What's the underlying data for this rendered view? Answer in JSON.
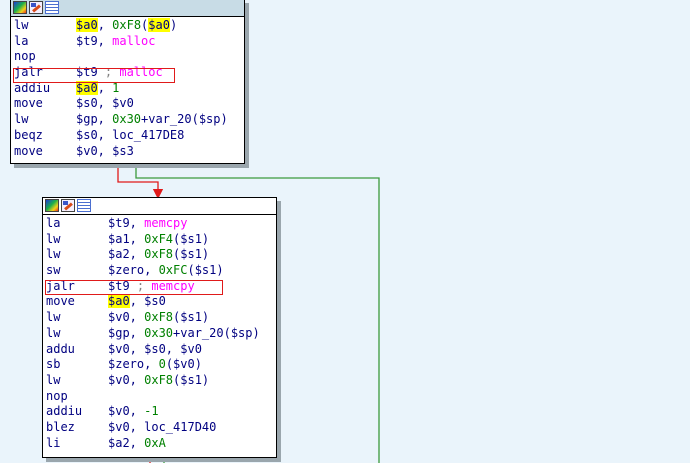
{
  "colors": {
    "background": "#eaf4fb",
    "mnemonic_text": "#000080",
    "symbol": "#ff00ff",
    "number": "#008000",
    "register_highlight": "#ffff00",
    "comment": "#808080",
    "edge_true": "#e01a1a",
    "edge_false": "#3c9a3c"
  },
  "header_icons": [
    "graph-overview-icon",
    "edit-node-icon",
    "listing-icon"
  ],
  "block1": {
    "lines": [
      {
        "mn": "lw",
        "ops": [
          {
            "t": "$a0",
            "k": "hl"
          },
          {
            "t": ", "
          },
          {
            "t": "0xF8",
            "k": "num"
          },
          {
            "t": "("
          },
          {
            "t": "$a0",
            "k": "hl"
          },
          {
            "t": ")"
          }
        ]
      },
      {
        "mn": "la",
        "ops": [
          {
            "t": "$t9, "
          },
          {
            "t": "malloc",
            "k": "sym"
          }
        ]
      },
      {
        "mn": "nop",
        "ops": []
      },
      {
        "mn": "jalr",
        "ops": [
          {
            "t": "$t9 "
          },
          {
            "t": "; ",
            "k": "cmt"
          },
          {
            "t": "malloc",
            "k": "sym"
          }
        ],
        "boxed": true
      },
      {
        "mn": "addiu",
        "ops": [
          {
            "t": "$a0",
            "k": "hl"
          },
          {
            "t": ", "
          },
          {
            "t": "1",
            "k": "num"
          }
        ]
      },
      {
        "mn": "move",
        "ops": [
          {
            "t": "$s0, $v0"
          }
        ]
      },
      {
        "mn": "lw",
        "ops": [
          {
            "t": "$gp, "
          },
          {
            "t": "0x30",
            "k": "num"
          },
          {
            "t": "+var_20($sp)"
          }
        ]
      },
      {
        "mn": "beqz",
        "ops": [
          {
            "t": "$s0, loc_417DE8"
          }
        ]
      },
      {
        "mn": "move",
        "ops": [
          {
            "t": "$v0, $s3"
          }
        ]
      }
    ]
  },
  "block2": {
    "lines": [
      {
        "mn": "la",
        "ops": [
          {
            "t": "$t9, "
          },
          {
            "t": "memcpy",
            "k": "sym"
          }
        ]
      },
      {
        "mn": "lw",
        "ops": [
          {
            "t": "$a1, "
          },
          {
            "t": "0xF4",
            "k": "num"
          },
          {
            "t": "($s1)"
          }
        ]
      },
      {
        "mn": "lw",
        "ops": [
          {
            "t": "$a2, "
          },
          {
            "t": "0xF8",
            "k": "num"
          },
          {
            "t": "($s1)"
          }
        ]
      },
      {
        "mn": "sw",
        "ops": [
          {
            "t": "$zero, "
          },
          {
            "t": "0xFC",
            "k": "num"
          },
          {
            "t": "($s1)"
          }
        ]
      },
      {
        "mn": "jalr",
        "ops": [
          {
            "t": "$t9 "
          },
          {
            "t": "; ",
            "k": "cmt"
          },
          {
            "t": "memcpy",
            "k": "sym"
          }
        ],
        "boxed": true
      },
      {
        "mn": "move",
        "ops": [
          {
            "t": "$a0",
            "k": "hl"
          },
          {
            "t": ", $s0"
          }
        ]
      },
      {
        "mn": "lw",
        "ops": [
          {
            "t": "$v0, "
          },
          {
            "t": "0xF8",
            "k": "num"
          },
          {
            "t": "($s1)"
          }
        ]
      },
      {
        "mn": "lw",
        "ops": [
          {
            "t": "$gp, "
          },
          {
            "t": "0x30",
            "k": "num"
          },
          {
            "t": "+var_20($sp)"
          }
        ]
      },
      {
        "mn": "addu",
        "ops": [
          {
            "t": "$v0, $s0, $v0"
          }
        ]
      },
      {
        "mn": "sb",
        "ops": [
          {
            "t": "$zero, "
          },
          {
            "t": "0",
            "k": "num"
          },
          {
            "t": "($v0)"
          }
        ]
      },
      {
        "mn": "lw",
        "ops": [
          {
            "t": "$v0, "
          },
          {
            "t": "0xF8",
            "k": "num"
          },
          {
            "t": "($s1)"
          }
        ]
      },
      {
        "mn": "nop",
        "ops": []
      },
      {
        "mn": "addiu",
        "ops": [
          {
            "t": "$v0, "
          },
          {
            "t": "-1",
            "k": "num"
          }
        ]
      },
      {
        "mn": "blez",
        "ops": [
          {
            "t": "$v0, loc_417D40"
          }
        ]
      },
      {
        "mn": "li",
        "ops": [
          {
            "t": "$a2, "
          },
          {
            "t": "0xA",
            "k": "num"
          }
        ]
      }
    ]
  }
}
